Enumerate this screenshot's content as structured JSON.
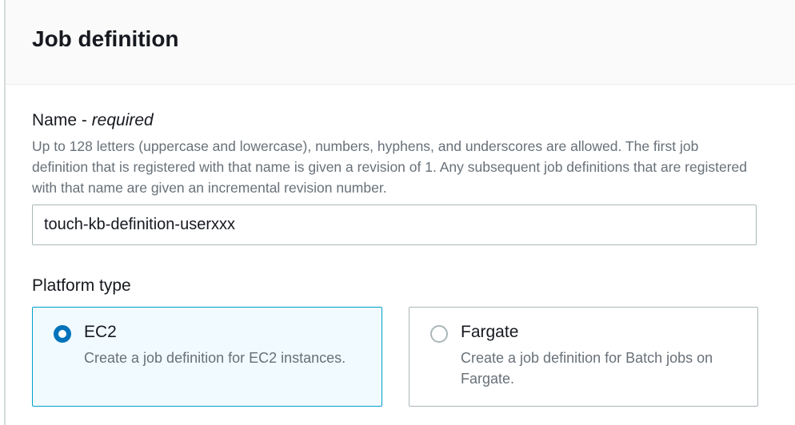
{
  "header": {
    "title": "Job definition"
  },
  "name_field": {
    "label": "Name - ",
    "required": "required",
    "description": "Up to 128 letters (uppercase and lowercase), numbers, hyphens, and underscores are allowed. The first job definition that is registered with that name is given a revision of 1. Any subsequent job definitions that are registered with that name are given an incremental revision number.",
    "value": "touch-kb-definition-userxxx"
  },
  "platform_type": {
    "label": "Platform type",
    "options": [
      {
        "title": "EC2",
        "description": "Create a job definition for EC2 instances.",
        "selected": true
      },
      {
        "title": "Fargate",
        "description": "Create a job definition for Batch jobs on Fargate.",
        "selected": false
      }
    ]
  },
  "colors": {
    "accent": "#0073bb",
    "selected_bg": "#f1faff",
    "selected_border": "#00a1c9"
  }
}
